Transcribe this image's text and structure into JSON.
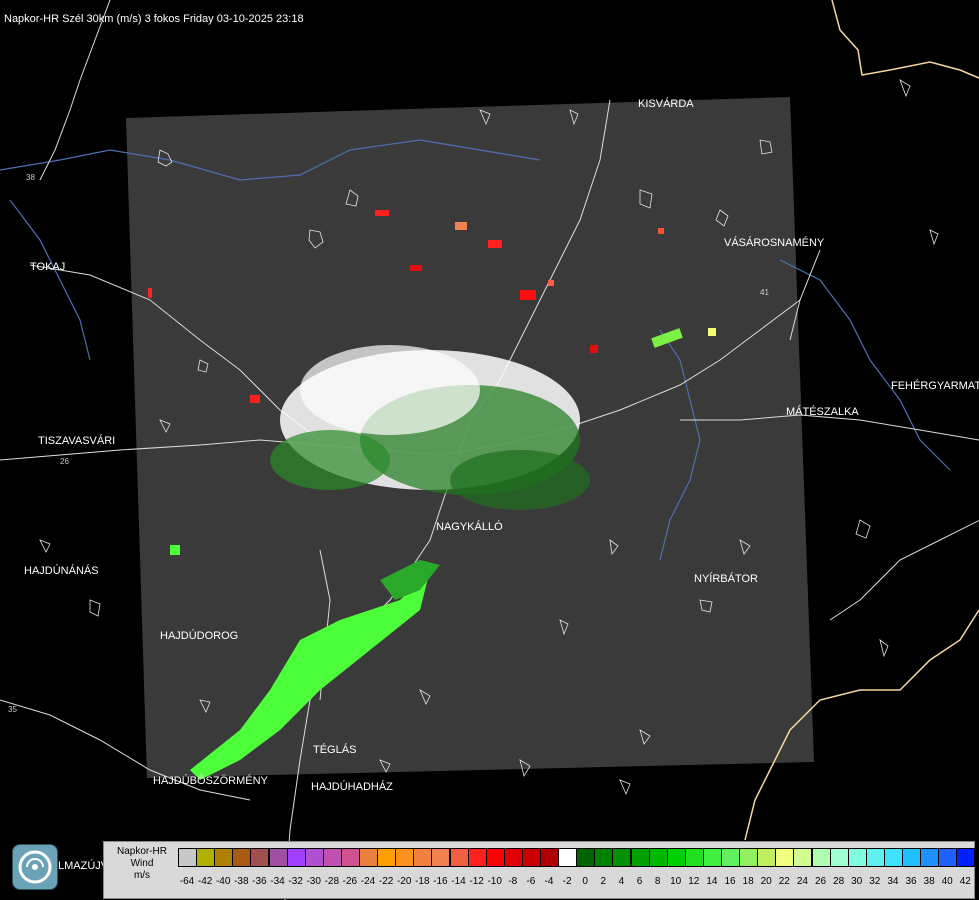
{
  "header": {
    "title": "Napkor-HR Szél 30km (m/s) 3 fokos Friday 03-10-2025 23:18"
  },
  "cities": [
    {
      "name": "KISVÁRDA",
      "id": "kisvarda"
    },
    {
      "name": "TOKAJ",
      "id": "tokaj"
    },
    {
      "name": "VÁSÁROSNAMÉNY",
      "id": "vasarosnameny"
    },
    {
      "name": "FEHÉRGYARMAT",
      "id": "fehergyarmat"
    },
    {
      "name": "MÁTÉSZALKA",
      "id": "mateszalka"
    },
    {
      "name": "TISZAVASVÁRI",
      "id": "tiszavasvari"
    },
    {
      "name": "NYÍRBÁTOR",
      "id": "nyirbator"
    },
    {
      "name": "HAJDÚNÁNÁS",
      "id": "hajdunanas"
    },
    {
      "name": "NAGYKÁLLÓ",
      "id": "nagykallo"
    },
    {
      "name": "HAJDÚDOROG",
      "id": "hajdudorog"
    },
    {
      "name": "TÉGLÁS",
      "id": "teglas"
    },
    {
      "name": "HAJDÚBÖSZÖRMÉNY",
      "id": "hajduboszormeny"
    },
    {
      "name": "HAJDÚHADHÁZ",
      "id": "hajduhadhaz"
    }
  ],
  "roads": [
    "38",
    "26",
    "41",
    "35"
  ],
  "legend": {
    "label_lines": [
      "Napkor-HR",
      "Wind",
      "m/s"
    ],
    "ticks": [
      "-64",
      "-42",
      "-40",
      "-38",
      "-36",
      "-34",
      "-32",
      "-30",
      "-28",
      "-26",
      "-24",
      "-22",
      "-20",
      "-18",
      "-16",
      "-14",
      "-12",
      "-10",
      "-8",
      "-6",
      "-4",
      "-2",
      "0",
      "2",
      "4",
      "6",
      "8",
      "10",
      "12",
      "14",
      "16",
      "18",
      "20",
      "22",
      "24",
      "26",
      "28",
      "30",
      "32",
      "34",
      "36",
      "38",
      "40",
      "42"
    ],
    "colors": [
      "#c8c8c8",
      "#b0b000",
      "#b08000",
      "#a85a10",
      "#a05050",
      "#a050a0",
      "#a040ff",
      "#b050d0",
      "#c050b0",
      "#d05090",
      "#e88040",
      "#ffa000",
      "#ff9020",
      "#f08040",
      "#f08050",
      "#f06040",
      "#ff2020",
      "#ff0000",
      "#e00000",
      "#c80000",
      "#b00000",
      "#ffffff",
      "#006400",
      "#008000",
      "#009000",
      "#00a000",
      "#00b800",
      "#00d000",
      "#20e020",
      "#40f040",
      "#60f060",
      "#90f060",
      "#c0f060",
      "#f0ff80",
      "#d0ff90",
      "#b0ffb0",
      "#a0ffd0",
      "#80ffe0",
      "#60f0f0",
      "#40e0ff",
      "#20c0ff",
      "#2090ff",
      "#2060ff",
      "#0020ff"
    ]
  },
  "logo": {
    "text": "LMAZÚJVÁR"
  },
  "colors": {
    "radar_panel": "#3a3a3a",
    "border_line": "#ffffff",
    "river": "#4f6fb0",
    "country_border": "#f5d6a0"
  }
}
